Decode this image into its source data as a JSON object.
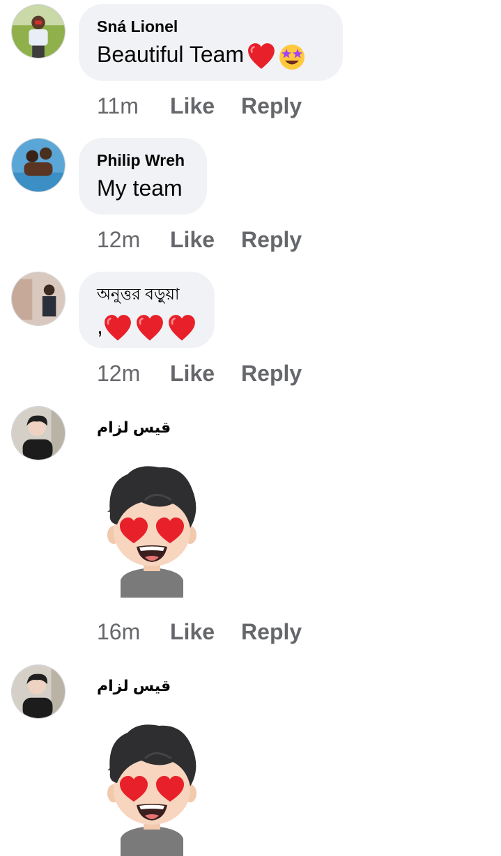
{
  "comments": [
    {
      "author": "Sná Lionel",
      "text": "Beautiful Team",
      "emojis": [
        "red-heart",
        "star-struck"
      ],
      "time": "11m",
      "like": "Like",
      "reply": "Reply"
    },
    {
      "author": "Philip Wreh",
      "text": "My team",
      "time": "12m",
      "like": "Like",
      "reply": "Reply"
    },
    {
      "author": "অনুত্তর বড়ুয়া",
      "text": ",",
      "emojis": [
        "red-heart",
        "red-heart",
        "red-heart"
      ],
      "time": "12m",
      "like": "Like",
      "reply": "Reply"
    },
    {
      "author": "قيس لزام",
      "sticker": "heart-eyes-avatar-sticker",
      "time": "16m",
      "like": "Like",
      "reply": "Reply"
    },
    {
      "author": "قيس لزام",
      "sticker": "heart-eyes-avatar-sticker"
    }
  ],
  "colors": {
    "bubble": "#f0f2f5",
    "meta": "#65676b",
    "text": "#050505",
    "heart": "#e8202a"
  }
}
